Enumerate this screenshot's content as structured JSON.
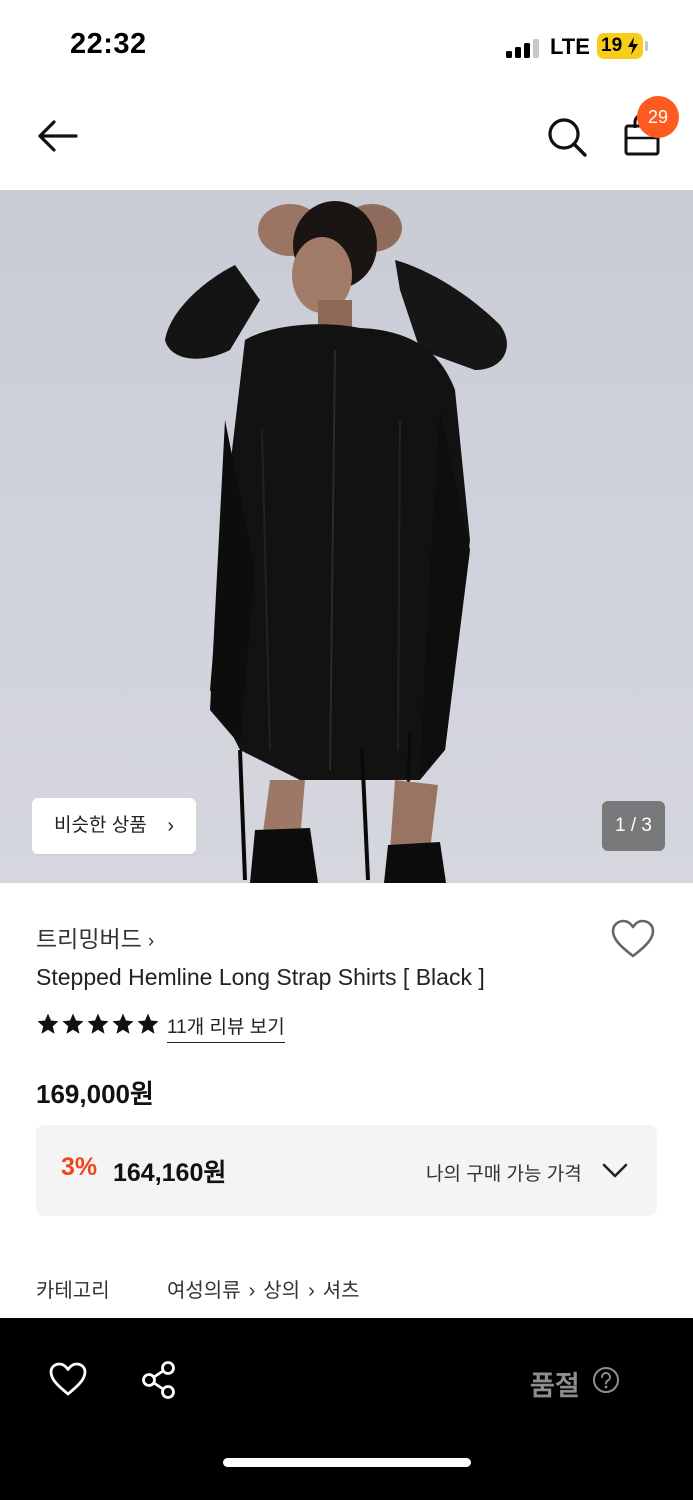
{
  "status_bar": {
    "time": "22:32",
    "network": "LTE",
    "battery": "19"
  },
  "header": {
    "cart_count": "29"
  },
  "hero": {
    "similar_label": "비슷한 상품",
    "counter": "1 / 3"
  },
  "product": {
    "brand": "트리밍버드",
    "title": "Stepped Hemline Long Strap Shirts [ Black ]",
    "rating": 5,
    "review_link": "11개 리뷰 보기",
    "price": "169,000원",
    "discount_percent": "3%",
    "discount_price": "164,160원",
    "my_price_label": "나의 구매 가능 가격"
  },
  "category": {
    "label": "카테고리",
    "path": [
      "여성의류",
      "상의",
      "셔츠"
    ]
  },
  "bottom_bar": {
    "status_label": "품절"
  },
  "colors": {
    "accent": "#ff5a1f",
    "discount": "#f0461b",
    "bar_bg": "#000000"
  }
}
